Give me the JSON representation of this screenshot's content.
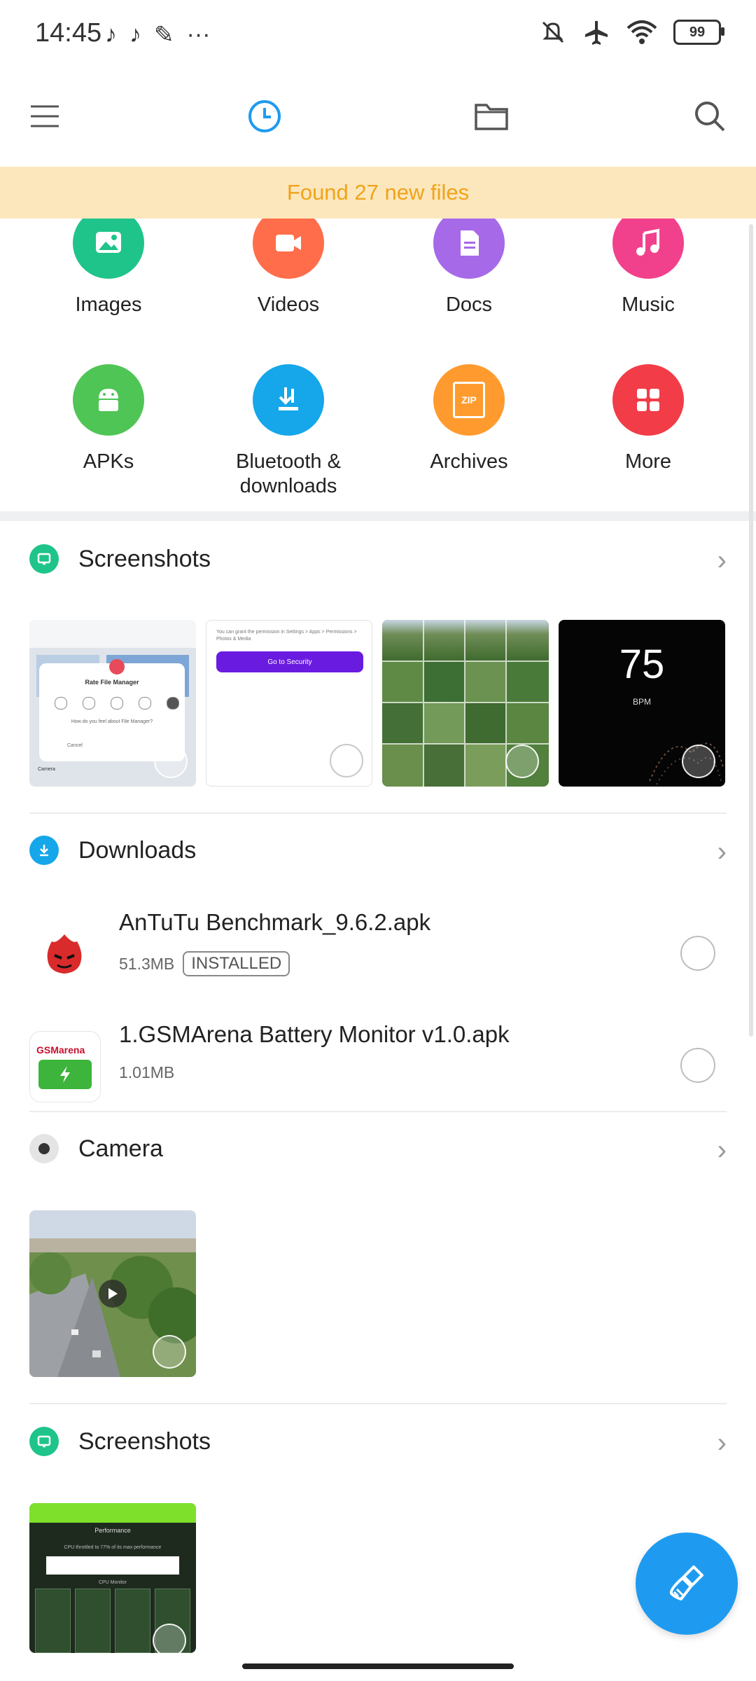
{
  "status": {
    "time": "14:45",
    "battery": "99",
    "more": "···"
  },
  "banner": {
    "text": "Found 27 new files"
  },
  "categories": [
    {
      "label": "Images",
      "color": "#1fc48a",
      "icon": "image-icon"
    },
    {
      "label": "Videos",
      "color": "#ff6d4a",
      "icon": "video-icon"
    },
    {
      "label": "Docs",
      "color": "#a669e8",
      "icon": "doc-icon"
    },
    {
      "label": "Music",
      "color": "#f2418c",
      "icon": "music-icon"
    },
    {
      "label": "APKs",
      "color": "#4fc555",
      "icon": "android-icon"
    },
    {
      "label": "Bluetooth &\ndownloads",
      "color": "#16a6ea",
      "icon": "bluetooth-download-icon"
    },
    {
      "label": "Archives",
      "color": "#ff9b2e",
      "icon": "zip-icon",
      "badge": "ZIP"
    },
    {
      "label": "More",
      "color": "#f23c48",
      "icon": "grid-icon"
    }
  ],
  "sections": {
    "screenshots1": {
      "title": "Screenshots",
      "color": "#1fc48a"
    },
    "downloads": {
      "title": "Downloads",
      "color": "#16a6ea"
    },
    "camera": {
      "title": "Camera",
      "color": "#555555"
    },
    "screenshots2": {
      "title": "Screenshots",
      "color": "#1fc48a"
    }
  },
  "thumbs1": {
    "t1": {
      "title": "Rate File Manager",
      "question": "How do you feel about File Manager?",
      "cancel": "Cancel",
      "camera": "Camera"
    },
    "t2": {
      "text": "You can grant the permission in Settings > Apps > Permissions > Photos & Media",
      "button": "Go to Security"
    },
    "t4": {
      "value": "75",
      "unit": "BPM"
    }
  },
  "downloads": [
    {
      "name": "AnTuTu Benchmark_9.6.2.apk",
      "size": "51.3MB",
      "badge": "INSTALLED"
    },
    {
      "name": "1.GSMArena Battery Monitor v1.0.apk",
      "size": "1.01MB",
      "badge": ""
    }
  ],
  "thumbs2": {
    "s1": {
      "title": "Performance",
      "note": "CPU throttled to 77% of its max performance",
      "monitor": "CPU Monitor"
    }
  },
  "gsm_logo": "GSMarena"
}
